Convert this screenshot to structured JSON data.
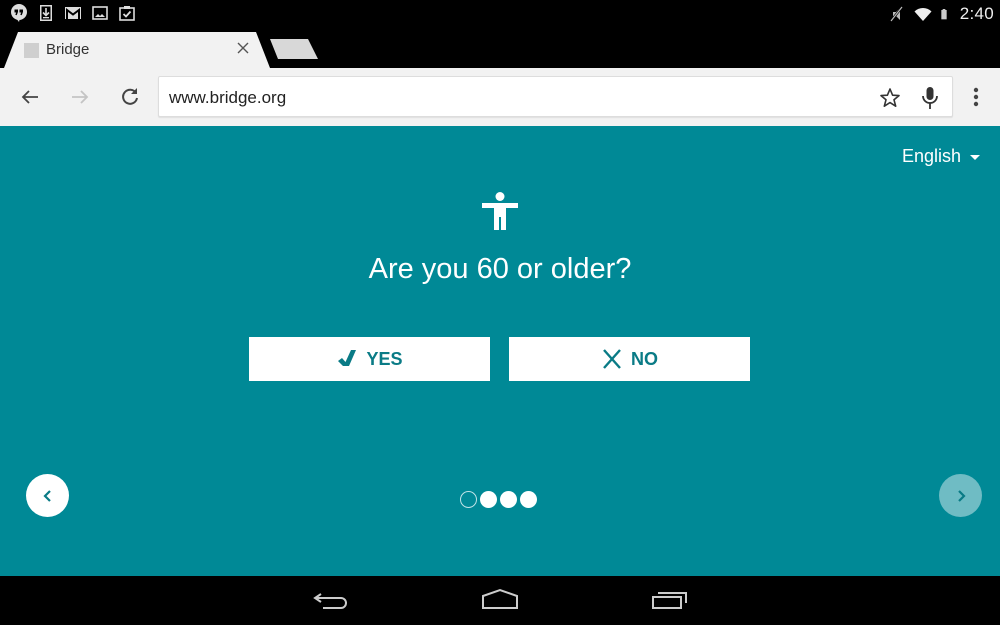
{
  "status_bar": {
    "left_icons": [
      "hangouts-icon",
      "download-icon",
      "gmail-icon",
      "image-icon",
      "clipboard-check-icon"
    ],
    "right_icons": [
      "mute-icon",
      "wifi-icon",
      "battery-icon"
    ],
    "time": "2:40"
  },
  "browser": {
    "tab": {
      "title": "Bridge"
    },
    "url": "www.bridge.org"
  },
  "page": {
    "language": "English",
    "question": "Are you 60 or older?",
    "yes_label": "YES",
    "no_label": "NO",
    "pager": {
      "total": 4,
      "current": 1
    }
  },
  "colors": {
    "background": "#008996",
    "button_text": "#0a7b86",
    "next_button": "#6fbcc4"
  }
}
